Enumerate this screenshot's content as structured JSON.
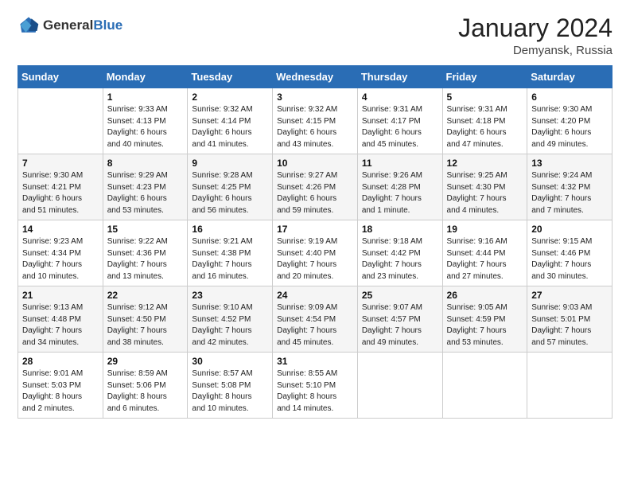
{
  "header": {
    "logo_general": "General",
    "logo_blue": "Blue",
    "main_title": "January 2024",
    "sub_title": "Demyansk, Russia"
  },
  "columns": [
    "Sunday",
    "Monday",
    "Tuesday",
    "Wednesday",
    "Thursday",
    "Friday",
    "Saturday"
  ],
  "weeks": [
    [
      {
        "day": "",
        "info": ""
      },
      {
        "day": "1",
        "info": "Sunrise: 9:33 AM\nSunset: 4:13 PM\nDaylight: 6 hours\nand 40 minutes."
      },
      {
        "day": "2",
        "info": "Sunrise: 9:32 AM\nSunset: 4:14 PM\nDaylight: 6 hours\nand 41 minutes."
      },
      {
        "day": "3",
        "info": "Sunrise: 9:32 AM\nSunset: 4:15 PM\nDaylight: 6 hours\nand 43 minutes."
      },
      {
        "day": "4",
        "info": "Sunrise: 9:31 AM\nSunset: 4:17 PM\nDaylight: 6 hours\nand 45 minutes."
      },
      {
        "day": "5",
        "info": "Sunrise: 9:31 AM\nSunset: 4:18 PM\nDaylight: 6 hours\nand 47 minutes."
      },
      {
        "day": "6",
        "info": "Sunrise: 9:30 AM\nSunset: 4:20 PM\nDaylight: 6 hours\nand 49 minutes."
      }
    ],
    [
      {
        "day": "7",
        "info": "Sunrise: 9:30 AM\nSunset: 4:21 PM\nDaylight: 6 hours\nand 51 minutes."
      },
      {
        "day": "8",
        "info": "Sunrise: 9:29 AM\nSunset: 4:23 PM\nDaylight: 6 hours\nand 53 minutes."
      },
      {
        "day": "9",
        "info": "Sunrise: 9:28 AM\nSunset: 4:25 PM\nDaylight: 6 hours\nand 56 minutes."
      },
      {
        "day": "10",
        "info": "Sunrise: 9:27 AM\nSunset: 4:26 PM\nDaylight: 6 hours\nand 59 minutes."
      },
      {
        "day": "11",
        "info": "Sunrise: 9:26 AM\nSunset: 4:28 PM\nDaylight: 7 hours\nand 1 minute."
      },
      {
        "day": "12",
        "info": "Sunrise: 9:25 AM\nSunset: 4:30 PM\nDaylight: 7 hours\nand 4 minutes."
      },
      {
        "day": "13",
        "info": "Sunrise: 9:24 AM\nSunset: 4:32 PM\nDaylight: 7 hours\nand 7 minutes."
      }
    ],
    [
      {
        "day": "14",
        "info": "Sunrise: 9:23 AM\nSunset: 4:34 PM\nDaylight: 7 hours\nand 10 minutes."
      },
      {
        "day": "15",
        "info": "Sunrise: 9:22 AM\nSunset: 4:36 PM\nDaylight: 7 hours\nand 13 minutes."
      },
      {
        "day": "16",
        "info": "Sunrise: 9:21 AM\nSunset: 4:38 PM\nDaylight: 7 hours\nand 16 minutes."
      },
      {
        "day": "17",
        "info": "Sunrise: 9:19 AM\nSunset: 4:40 PM\nDaylight: 7 hours\nand 20 minutes."
      },
      {
        "day": "18",
        "info": "Sunrise: 9:18 AM\nSunset: 4:42 PM\nDaylight: 7 hours\nand 23 minutes."
      },
      {
        "day": "19",
        "info": "Sunrise: 9:16 AM\nSunset: 4:44 PM\nDaylight: 7 hours\nand 27 minutes."
      },
      {
        "day": "20",
        "info": "Sunrise: 9:15 AM\nSunset: 4:46 PM\nDaylight: 7 hours\nand 30 minutes."
      }
    ],
    [
      {
        "day": "21",
        "info": "Sunrise: 9:13 AM\nSunset: 4:48 PM\nDaylight: 7 hours\nand 34 minutes."
      },
      {
        "day": "22",
        "info": "Sunrise: 9:12 AM\nSunset: 4:50 PM\nDaylight: 7 hours\nand 38 minutes."
      },
      {
        "day": "23",
        "info": "Sunrise: 9:10 AM\nSunset: 4:52 PM\nDaylight: 7 hours\nand 42 minutes."
      },
      {
        "day": "24",
        "info": "Sunrise: 9:09 AM\nSunset: 4:54 PM\nDaylight: 7 hours\nand 45 minutes."
      },
      {
        "day": "25",
        "info": "Sunrise: 9:07 AM\nSunset: 4:57 PM\nDaylight: 7 hours\nand 49 minutes."
      },
      {
        "day": "26",
        "info": "Sunrise: 9:05 AM\nSunset: 4:59 PM\nDaylight: 7 hours\nand 53 minutes."
      },
      {
        "day": "27",
        "info": "Sunrise: 9:03 AM\nSunset: 5:01 PM\nDaylight: 7 hours\nand 57 minutes."
      }
    ],
    [
      {
        "day": "28",
        "info": "Sunrise: 9:01 AM\nSunset: 5:03 PM\nDaylight: 8 hours\nand 2 minutes."
      },
      {
        "day": "29",
        "info": "Sunrise: 8:59 AM\nSunset: 5:06 PM\nDaylight: 8 hours\nand 6 minutes."
      },
      {
        "day": "30",
        "info": "Sunrise: 8:57 AM\nSunset: 5:08 PM\nDaylight: 8 hours\nand 10 minutes."
      },
      {
        "day": "31",
        "info": "Sunrise: 8:55 AM\nSunset: 5:10 PM\nDaylight: 8 hours\nand 14 minutes."
      },
      {
        "day": "",
        "info": ""
      },
      {
        "day": "",
        "info": ""
      },
      {
        "day": "",
        "info": ""
      }
    ]
  ]
}
